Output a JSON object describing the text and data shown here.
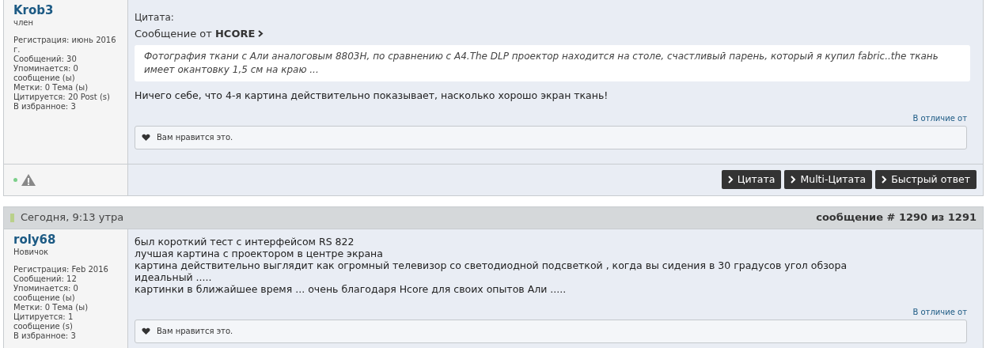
{
  "posts": [
    {
      "user": {
        "name": "Krob3",
        "rank": "член",
        "stats": [
          "Регистрация: июнь 2016 г.",
          "Сообщений: 30",
          "Упоминается: 0 сообщение (ы)",
          "Метки: 0 Тема (ы)",
          "Цитируется: 20 Post (s)",
          "В избранное: 3"
        ]
      },
      "quote": {
        "label": "Цитата:",
        "from": "Сообщение от **HCORE**",
        "text": "Фотография ткани с Али аналоговым 8803H, по сравнению с A4.The DLP проектор находится на столе, счастливый парень, который я купил fabric..the ткань имеет окантовку 1,5 см на краю ..."
      },
      "lines": [
        "Ничего себе, что 4-я картина действительно показывает, насколько хорошо экран ткань!"
      ],
      "unlike": "В отличие от",
      "likes": "Вам нравится это.",
      "footer": {
        "online": true,
        "buttons": [
          "Цитата",
          "Multi-Цитата",
          "Быстрый ответ"
        ]
      }
    },
    {
      "header": {
        "date": "Сегодня, 9:13 утра",
        "number": "сообщение # 1290 из 1291"
      },
      "user": {
        "name": "roly68",
        "rank": "Новичок",
        "stats": [
          "Регистрация: Feb 2016",
          "Сообщений: 12",
          "Упоминается: 0 сообщение (ы)",
          "Метки: 0 Тема (ы)",
          "Цитируется: 1 сообщение (s)",
          "В избранное: 3"
        ]
      },
      "lines": [
        "был короткий тест с интерфейсом RS 822",
        "лучшая картина с проектором в центре экрана",
        "картина действительно выглядит как огромный телевизор со светодиодной подсветкой , когда вы сидения в 30 градусов угол обзора",
        "идеальный .....",
        "картинки в ближайшее время ... очень благодаря Hcore для своих опытов Али ....."
      ],
      "unlike": "В отличие от",
      "likes": "Вам нравится это."
    }
  ]
}
